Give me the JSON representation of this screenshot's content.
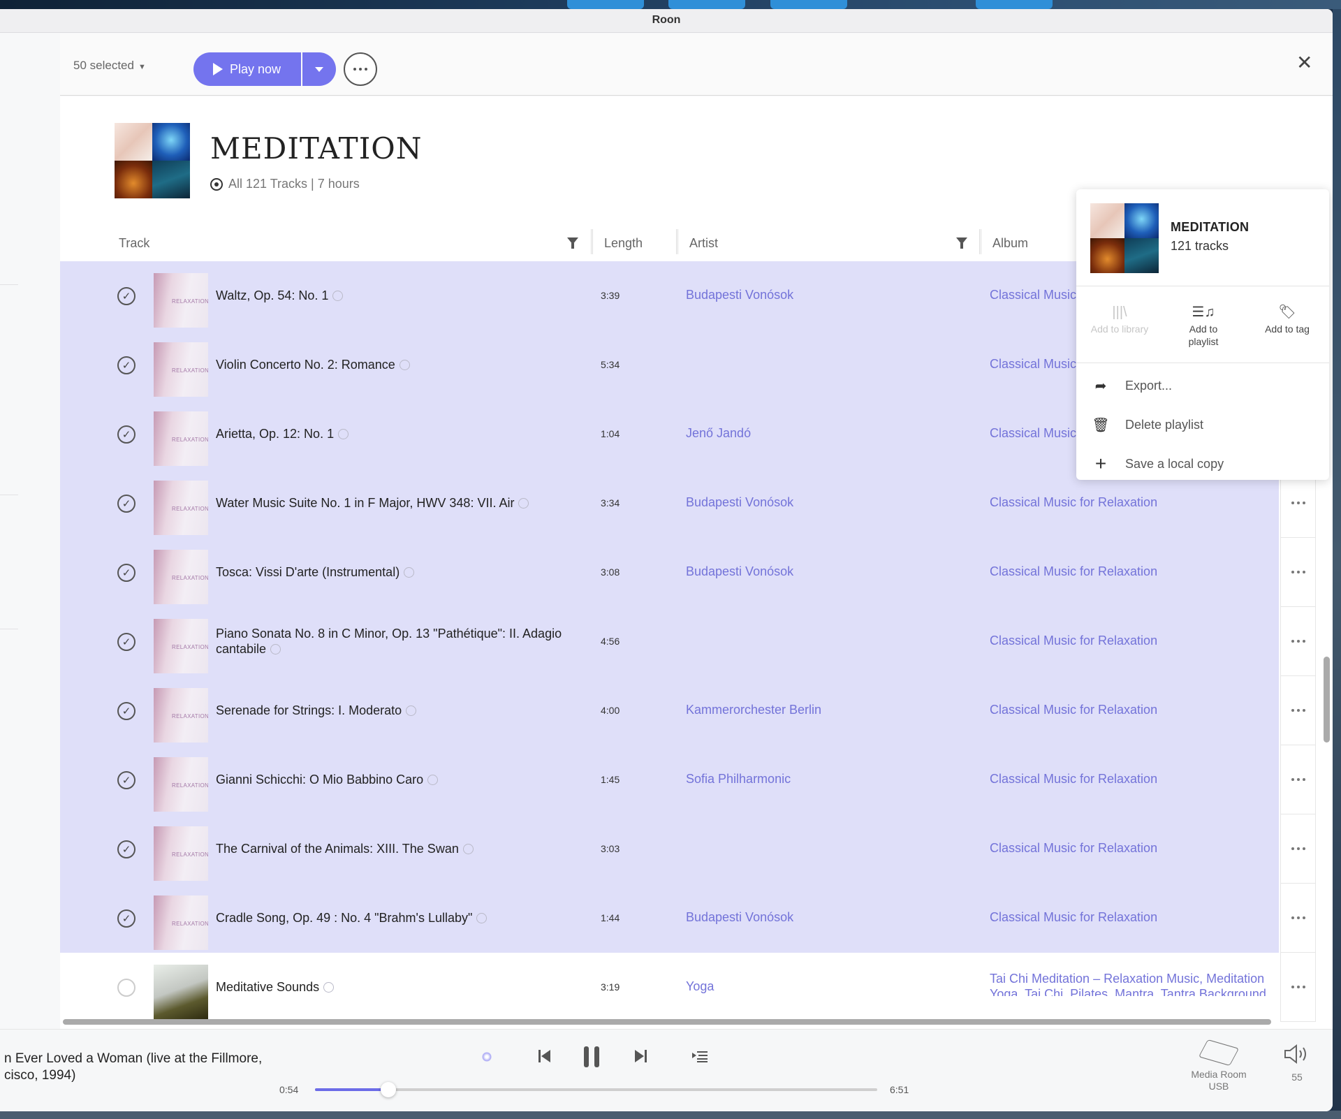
{
  "window": {
    "title": "Roon"
  },
  "selection_bar": {
    "selected_label": "50 selected",
    "play_now_label": "Play now"
  },
  "playlist": {
    "title": "MEDITATION",
    "subtitle": "All 121 Tracks | 7 hours",
    "play_now_label": "Play now"
  },
  "table": {
    "columns": {
      "track": "Track",
      "length": "Length",
      "artist": "Artist",
      "album": "Album"
    },
    "rows": [
      {
        "title": "Waltz, Op. 54: No. 1",
        "length": "3:39",
        "artist": "Budapesti Vonósok",
        "album": "Classical Music for Relaxation",
        "selected": true
      },
      {
        "title": "Violin Concerto No. 2: Romance",
        "length": "5:34",
        "artist": "",
        "album": "Classical Music for Relaxation",
        "selected": true
      },
      {
        "title": "Arietta, Op. 12: No. 1",
        "length": "1:04",
        "artist": "Jenő Jandó",
        "album": "Classical Music for Relaxation",
        "selected": true
      },
      {
        "title": "Water Music Suite No. 1 in F Major, HWV 348: VII. Air",
        "length": "3:34",
        "artist": "Budapesti Vonósok",
        "album": "Classical Music for Relaxation",
        "selected": true
      },
      {
        "title": "Tosca: Vissi D'arte (Instrumental)",
        "length": "3:08",
        "artist": "Budapesti Vonósok",
        "album": "Classical Music for Relaxation",
        "selected": true
      },
      {
        "title": "Piano Sonata No. 8 in C Minor, Op. 13 \"Pathétique\": II. Adagio cantabile",
        "length": "4:56",
        "artist": "",
        "album": "Classical Music for Relaxation",
        "selected": true
      },
      {
        "title": "Serenade for Strings: I. Moderato",
        "length": "4:00",
        "artist": "Kammerorchester Berlin",
        "album": "Classical Music for Relaxation",
        "selected": true
      },
      {
        "title": "Gianni Schicchi: O Mio Babbino Caro",
        "length": "1:45",
        "artist": "Sofia Philharmonic",
        "album": "Classical Music for Relaxation",
        "selected": true
      },
      {
        "title": "The Carnival of the Animals: XIII. The Swan",
        "length": "3:03",
        "artist": "",
        "album": "Classical Music for Relaxation",
        "selected": true
      },
      {
        "title": "Cradle Song, Op. 49 : No. 4 \"Brahm's Lullaby\"",
        "length": "1:44",
        "artist": "Budapesti Vonósok",
        "album": "Classical Music for Relaxation",
        "selected": true
      },
      {
        "title": "Meditative Sounds",
        "length": "3:19",
        "artist": "Yoga",
        "album": "Tai Chi Meditation – Relaxation Music, Meditation Yoga, Tai Chi, Pilates, Mantra, Tantra Background",
        "selected": false
      }
    ],
    "album_art_label": "RELAXATION"
  },
  "context_menu": {
    "title": "MEDITATION",
    "subtitle": "121 tracks",
    "actions": [
      {
        "label": "Add to library",
        "icon": "library-icon",
        "enabled": false
      },
      {
        "label": "Add to playlist",
        "icon": "playlist-add-icon",
        "enabled": true
      },
      {
        "label": "Add to tag",
        "icon": "tag-icon",
        "enabled": true
      }
    ],
    "items": [
      {
        "label": "Export...",
        "icon": "export-arrow-icon"
      },
      {
        "label": "Delete playlist",
        "icon": "trash-icon"
      },
      {
        "label": "Save a local copy",
        "icon": "plus-icon"
      }
    ]
  },
  "now_playing": {
    "title": "n Ever Loved a Woman (live at the Fillmore, cisco, 1994)",
    "elapsed": "0:54",
    "duration": "6:51",
    "progress_fraction": 0.131,
    "zone_name": "Media Room USB",
    "volume": "55"
  },
  "colors": {
    "accent": "#7474ee",
    "selected_row": "#dfdff9",
    "link": "#7373d9"
  }
}
